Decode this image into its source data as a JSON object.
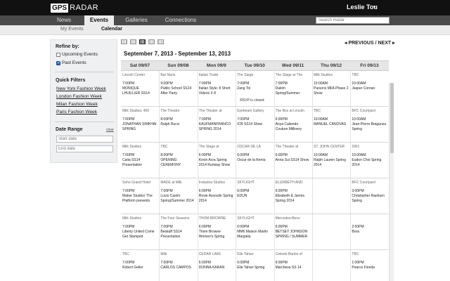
{
  "app": {
    "logo_box": "GPS",
    "logo_text": "RADAR",
    "user": "Leslie Tou",
    "user_caret": "▾"
  },
  "nav": {
    "tabs": [
      {
        "label": "News",
        "active": false
      },
      {
        "label": "Events",
        "active": true
      },
      {
        "label": "Galleries",
        "active": false
      },
      {
        "label": "Connections",
        "active": false
      }
    ]
  },
  "search": {
    "placeholder": "Search Radar"
  },
  "subnav": {
    "items": [
      {
        "label": "My Events",
        "active": false
      },
      {
        "label": "Calendar",
        "active": true
      }
    ]
  },
  "sidebar": {
    "refine_title": "Refine by:",
    "upcoming_label": "Upcoming Events",
    "upcoming_checked": false,
    "past_label": "Past Events",
    "past_checked": true,
    "quick_title": "Quick Filters",
    "quick_links": [
      "New York Fashion Week",
      "London Fashion Week",
      "Milan Fashion Week",
      "Paris Fashion Week"
    ],
    "date_title": "Date Range",
    "clear_label": "clear",
    "start_placeholder": "Start date",
    "end_placeholder": "End date"
  },
  "views": {
    "icons": [
      "list-view-icon",
      "compact-list-icon",
      "grid-view-icon",
      "week-view-icon",
      "calendar-icon"
    ],
    "active": "week-view-icon"
  },
  "pager": {
    "label": "◂ PREVIOUS / NEXT ▸"
  },
  "calendar": {
    "range": "September 7, 2013 - September 13, 2013",
    "days": [
      "Sat 09/07",
      "Sun 09/08",
      "Mon 09/9",
      "Tue 09/10",
      "Wed 09/11",
      "Thu 09/12",
      "Fri 09/13"
    ],
    "columns": [
      [
        {
          "venue": "Lincoln Center",
          "time": "7:00PM",
          "title": "MONIQUE LHUILLIER SS14"
        },
        {
          "venue": "Milk Studios, 450",
          "time": "7:00PM",
          "title": "JONATHAN SIMKHAI SPRING"
        },
        {
          "venue": "Milk Studios",
          "time": "7:00PM",
          "title": "Catia SS14 Presentation"
        },
        {
          "venue": "Soho Grand Hotel",
          "time": "7:00PM",
          "title": "Maker Studios' The Platform presents"
        },
        {
          "venue": "Milk Studios",
          "time": "7:00PM",
          "title": "Liberty United Come Get Stamped"
        },
        {
          "venue": "TBC",
          "time": "7:00PM",
          "title": "Robert Geller"
        }
      ],
      [
        {
          "venue": "Bar Naris",
          "time": "9:00PM",
          "title": "Public School SS14 After Party"
        },
        {
          "venue": "The Theatre",
          "time": "8:00PM",
          "title": "Ralph Rucci"
        },
        {
          "venue": "TBC",
          "time": "8:00PM",
          "title": "OPENING CEREMONY"
        },
        {
          "venue": "MADE at Milk",
          "time": "7:00PM",
          "title": "Lucio Castro Spring/Summer 2014"
        },
        {
          "venue": "The Four Seasons",
          "time": "7:00PM",
          "title": "Belstaff SS14 Presentation"
        },
        {
          "venue": "Milk",
          "time": "7:00PM",
          "title": "CARLOS CAMPOS"
        }
      ],
      [
        {
          "venue": "Italian Trade",
          "time": "7:00PM",
          "title": "Italian Style: 8 Short Videos X 8"
        },
        {
          "venue": "The Theater at",
          "time": "7:00PM",
          "title": "KAUFMANFRANCO SPRING 2014"
        },
        {
          "venue": "The Stage at",
          "time": "6:00PM",
          "title": "Kevin Acra Spring 2014 Runway Show"
        },
        {
          "venue": "Industria Studios",
          "time": "6:00PM",
          "title": "Rosie Assoulin Spring 2014"
        },
        {
          "venue": "THOM BROWNE",
          "time": "6:00PM",
          "title": "Thom Browne Women's Spring"
        },
        {
          "venue": "CEDAR LAKE",
          "time": "6:00PM",
          "title": "DONNA KARAN"
        }
      ],
      [
        {
          "venue": "The Stage",
          "time": "7:00PM",
          "title": "Zang Toi",
          "note": "RSVP is closed"
        },
        {
          "venue": "Eyebeam Gallery",
          "time": "7:00PM",
          "title": "ICB SS14 Show"
        },
        {
          "venue": "OSCAR DE LA",
          "time": "6:00PM",
          "title": "Oscar de la Renta"
        },
        {
          "venue": "SKYLIGHT",
          "time": "6:00PM",
          "title": "EDUN"
        },
        {
          "venue": "SKYLIGHT",
          "time": "6:00PM",
          "title": "MM6 Maison Martin Margiela"
        },
        {
          "venue": "Elie Tahari",
          "time": "6:00PM",
          "title": "Elie Tahari Spring"
        }
      ],
      [
        {
          "venue": "The Stage at The",
          "time": "7:00PM",
          "title": "Dakim Spring/Summer"
        },
        {
          "venue": "The Box at Lincoln",
          "time": "6:00PM",
          "title": "Anya Caliendo Couture Millinery"
        },
        {
          "venue": "The Theater at",
          "time": "6:00PM",
          "title": "Anna Sui SS14 Show"
        },
        {
          "venue": "ELIZABETH AND",
          "time": "6:00PM",
          "title": "Elizabeth & James Spring 2014"
        },
        {
          "venue": "Mercedes-Benz",
          "time": "6:00PM",
          "title": "BETSEY JOHNSON SPRING / SUMMER"
        },
        {
          "venue": "Celeste Barlon of",
          "time": "6:00PM",
          "title": "Marchesa SS 14"
        }
      ],
      [
        {
          "venue": "Milk Studios",
          "time": "10:00AM",
          "title": "Parsons MFA Phase 2 Show"
        },
        {
          "venue": "TBC",
          "time": "10:00AM",
          "title": "MANUEL CANOVAS"
        },
        {
          "venue": "ST. JOHN CENTER",
          "time": "10:00AM",
          "title": "Ralph Lauren Spring 2014"
        },
        {
          "venue": "",
          "time": "",
          "title": ""
        },
        {
          "venue": "",
          "time": "",
          "title": ""
        },
        {
          "venue": "",
          "time": "",
          "title": ""
        }
      ],
      [
        {
          "venue": "TBC",
          "time": "10:00AM",
          "title": "Jasper Conran"
        },
        {
          "venue": "BFC Courtyard",
          "time": "10:00AM",
          "title": "Jean-Pierre Braganza Spring"
        },
        {
          "venue": "SW1",
          "time": "10:00AM",
          "title": "Eudon Choi Spring 2014"
        },
        {
          "venue": "BFC Courtyard",
          "time": "3:00PM",
          "title": "Christopher Raeburn Spring"
        },
        {
          "venue": "",
          "time": "2:00PM",
          "title": "Bora"
        },
        {
          "venue": "TBC",
          "time": "1:00PM",
          "title": "Pearce Fionda"
        }
      ]
    ]
  }
}
